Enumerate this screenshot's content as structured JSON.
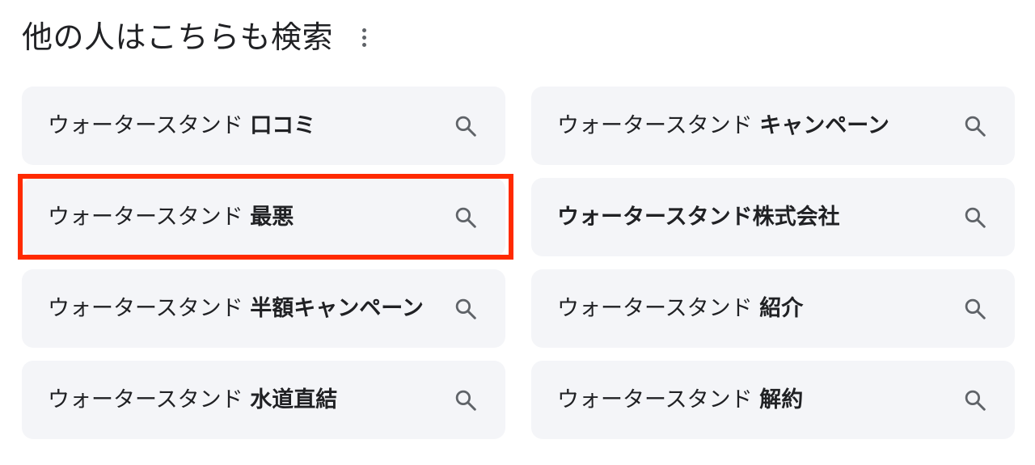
{
  "header": {
    "title": "他の人はこちらも検索"
  },
  "suggestions": [
    {
      "prefix": "ウォータースタンド ",
      "bold": "口コミ"
    },
    {
      "prefix": "ウォータースタンド ",
      "bold": "キャンペーン"
    },
    {
      "prefix": "ウォータースタンド ",
      "bold": "最悪"
    },
    {
      "prefix": "",
      "bold": "ウォータースタンド株式会社"
    },
    {
      "prefix": "ウォータースタンド ",
      "bold": "半額キャンペーン"
    },
    {
      "prefix": "ウォータースタンド ",
      "bold": "紹介"
    },
    {
      "prefix": "ウォータースタンド ",
      "bold": "水道直結"
    },
    {
      "prefix": "ウォータースタンド ",
      "bold": "解約"
    }
  ],
  "icons": {
    "more": "more-vert-icon",
    "search": "search-icon"
  },
  "colors": {
    "chip_background": "#f4f5f8",
    "highlight_border": "#ff2a00",
    "icon": "#5f6368"
  }
}
